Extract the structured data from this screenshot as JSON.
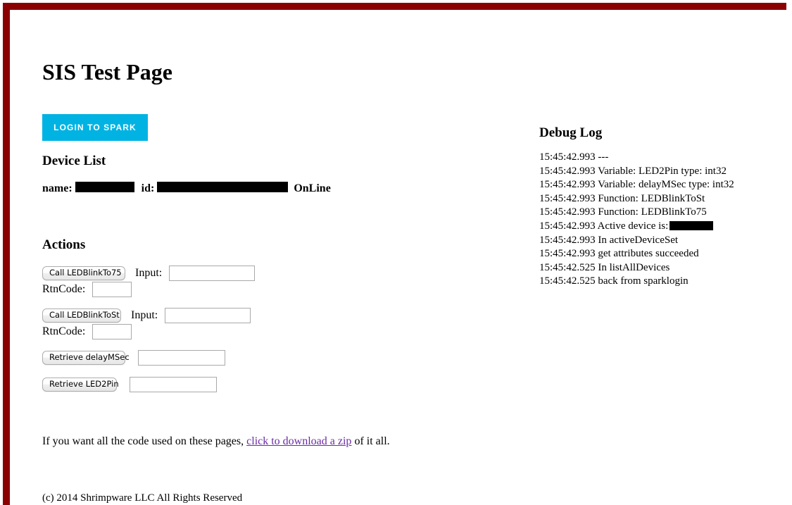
{
  "page": {
    "title": "SIS Test Page",
    "border_color": "#8b0000"
  },
  "login": {
    "label": "LOGIN TO SPARK",
    "color": "#00b3e3"
  },
  "device_list": {
    "heading": "Device List",
    "name_label": "name:",
    "id_label": "id:",
    "status": "OnLine",
    "name_value": "",
    "id_value": ""
  },
  "actions": {
    "heading": "Actions",
    "rows": [
      {
        "button_label": "Call LEDBlinkTo75",
        "input_label": "Input:",
        "input_value": "",
        "rtncode_label": "RtnCode:",
        "rtncode_value": ""
      },
      {
        "button_label": "Call LEDBlinkToSt",
        "input_label": "Input:",
        "input_value": "",
        "rtncode_label": "RtnCode:",
        "rtncode_value": ""
      }
    ],
    "retrieve_rows": [
      {
        "button_label": "Retrieve delayMSec",
        "value": ""
      },
      {
        "button_label": "Retrieve LED2Pin",
        "value": ""
      }
    ]
  },
  "footer": {
    "note_before": "If you want all the code used on these pages, ",
    "link_text": "click to download a zip",
    "note_after": " of it all.",
    "link_color": "#6a2ba5",
    "copyright": "(c) 2014 Shrimpware LLC All Rights Reserved"
  },
  "debug_log": {
    "heading": "Debug Log",
    "lines": [
      "15:45:42.993 ---",
      "15:45:42.993 Variable: LED2Pin type: int32",
      "15:45:42.993 Variable: delayMSec type: int32",
      "15:45:42.993 Function: LEDBlinkToSt",
      "15:45:42.993 Function: LEDBlinkTo75",
      "15:45:42.993 Active device is:",
      "15:45:42.993 In activeDeviceSet",
      "15:45:42.993 get attributes succeeded",
      "15:45:42.525 In listAllDevices",
      "15:45:42.525 back from sparklogin"
    ],
    "redacted_line_index": 5
  }
}
